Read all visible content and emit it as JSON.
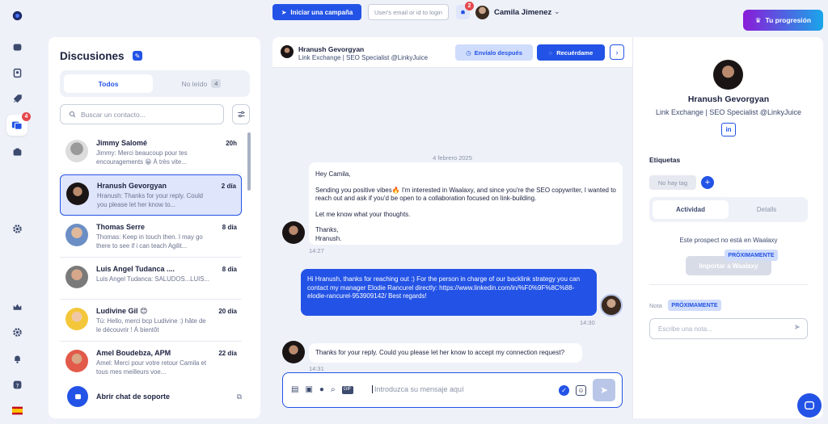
{
  "topbar": {
    "campaign_button": "Iniciar una campaña",
    "user_search_placeholder": "User's email or id to login",
    "notifications_count": "2",
    "user_name": "Camila Jimenez",
    "progress_button": "Tu progresión"
  },
  "rail": {
    "messages_badge": "4"
  },
  "discussions": {
    "title": "Discusiones",
    "tab_all": "Todos",
    "tab_unread": "No leído",
    "unread_count": "4",
    "search_placeholder": "Buscar un contacto...",
    "items": [
      {
        "name": "Jimmy Salomé",
        "date": "20h",
        "preview": "Jimmy: Merci beaucoup pour tes encouragements 😁 À très vite..."
      },
      {
        "name": "Hranush Gevorgyan",
        "date": "2 día",
        "preview": "Hranush: Thanks for your reply. Could you please let her know to..."
      },
      {
        "name": "Thomas Serre",
        "date": "8 día",
        "preview": "Thomas: Keep in touch then. I may go there to see if i can teach Agilit..."
      },
      {
        "name": "Luis Angel Tudanca ....",
        "date": "8 día",
        "preview": "Luis Angel Tudanca: SALUDOS...LUIS..."
      },
      {
        "name": "Ludivine Gil 😊",
        "date": "20 día",
        "preview": "Tú: Hello, merci bcp Ludivine :) hâte de le découvrir ! À bientôt"
      },
      {
        "name": "Amel Boudebza, APM",
        "date": "22 día",
        "preview": "Amel: Merci pour votre retour Camila et tous mes meilleurs voe..."
      }
    ],
    "support_label": "Abrir chat de soporte"
  },
  "chat": {
    "contact_name": "Hranush Gevorgyan",
    "contact_headline": "Link Exchange | SEO Specialist @LinkyJuice",
    "send_later": "Envíalo después",
    "remind_me": "Recuérdame",
    "date_separator": "4 febrero 2025",
    "messages": [
      {
        "line1": "Hey Camila,",
        "line2": "Sending you positive vibes🔥 I'm interested in Waalaxy, and since you're the SEO copywriter, I wanted to reach out and ask if you'd be open to a collaboration focused on link-building.",
        "line3": "Let me know what your thoughts.",
        "line4": "Thanks,",
        "line5": "Hranush.",
        "time": "14:27"
      },
      {
        "text": "Hi Hranush, thanks for reaching out :) For the person in charge of our backlink strategy you can contact my manager Elodie Rancurel directly: https://www.linkedin.com/in/%F0%9F%8C%88-elodie-rancurel-953909142/ Best regards!",
        "time": "14:30"
      },
      {
        "text": "Thanks for your reply. Could you please let her know to accept my connection request?",
        "time": "14:31"
      }
    ],
    "compose_placeholder": "Introduzca su mensaje aquí"
  },
  "profile": {
    "name": "Hranush Gevorgyan",
    "headline": "Link Exchange | SEO Specialist @LinkyJuice",
    "linkedin_label": "in",
    "tags_title": "Etiquetas",
    "no_tag": "No hay tag",
    "tab_activity": "Actividad",
    "tab_details": "Detalls",
    "not_in_waalaxy": "Este prospect no está en Waalaxy",
    "import_button": "Importar a Waalaxy",
    "soon": "PRÓXIMAMENTE",
    "note_label": "Nota",
    "note_placeholder": "Escribe una nota..."
  }
}
